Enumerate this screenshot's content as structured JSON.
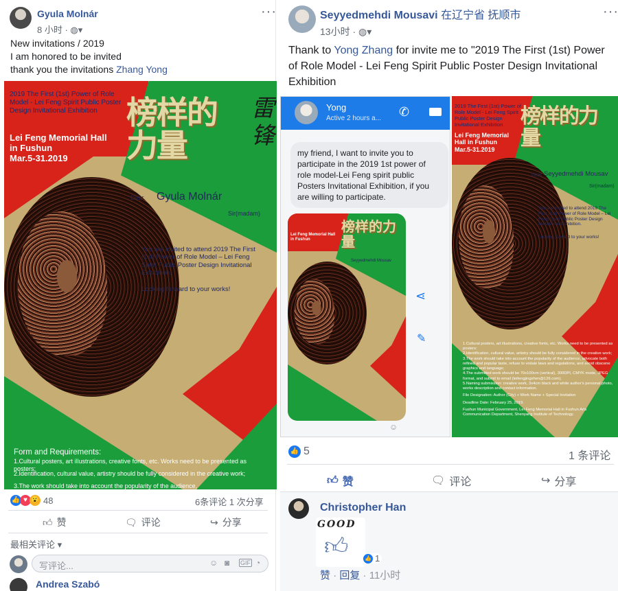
{
  "left_post": {
    "author": "Gyula Molnár",
    "time": "8 小时",
    "privacy_icon": "globe-icon",
    "body_lines": [
      "New invitations / 2019",
      "I am honored to be invited",
      "thank you the invitations "
    ],
    "mention": "Zhang Yong",
    "poster": {
      "title": "2019 The First (1st) Power of Role Model - Lei Feng Spirit Public Poster Design Invitational Exhibition",
      "venue": "Lei Feng Memorial Hall in Fushun",
      "dates": "Mar.5-31.2019",
      "dear": "Dear",
      "recipient": "Gyula Molnár",
      "sir": "Sir(madam)",
      "invite": "You are invited to attend 2019 The First (1st) Power of Role Model – Lei Feng Spirit Public Poster Design Invitational Exhibition.",
      "looking": "Looking forward to your works!",
      "form_head": "Form and Requirements:",
      "form_1": "1.Cultural posters, art illustrations, creative fonts, etc. Works need to be presented as posters:",
      "form_2": "2.Identification, cultural value, artistry should be fully considered in the creative work;",
      "form_3": "3.The work should take into account the popularity of the audience,",
      "calligraphy": "榜样的力量",
      "signature": "雷锋"
    },
    "reactions_count": "48",
    "comments_shares": "6条评论 1 次分享",
    "actions": {
      "like": "赞",
      "comment": "评论",
      "share": "分享"
    },
    "sort_label": "最相关评论",
    "comment_placeholder": "写评论...",
    "next_commenter": "Andrea Szabó"
  },
  "right_post": {
    "author": "Seyyedmehdi Mousavi",
    "location": "在辽宁省 抚顺市",
    "time": "13小时",
    "privacy_icon": "globe-icon",
    "body_prefix": "Thank to ",
    "mention": "Yong Zhang",
    "body_suffix": " for invite me to \"2019 The First (1st) Power of Role Model - Lei Feng Spirit Public Poster Design Invitational Exhibition",
    "messenger": {
      "contact": "Yong",
      "status": "Active 2 hours a...",
      "message": "my friend, I want to invite you to participate in the 2019 1st power of role model-Lei Feng spirit public Posters Invitational Exhibition, if you are willing to participate."
    },
    "poster": {
      "title": "2019 The First (1st) Power of Role Model - Lei Feng Spirit Public Poster Design Invitational Exhibition",
      "venue": "Lei Feng Memorial Hall in Fushun",
      "dates": "Mar.5-31.2019",
      "dear": "Dear",
      "recipient": "Seyyedmehdi Mousav",
      "sir": "Sir(madam)",
      "invite": "You are invited to attend 2019 The First (1st) Power of Role Model – Lei Feng Spirit Public Poster Design Invitational Exhibition.",
      "looking": "Looking forward to your works!",
      "form_1": "1.Cultural posters, art illustrations, creative fonts, etc. Works need to be presented as posters:",
      "form_2": "2.Identification, cultural value, artistry should be fully considered in the creative work;",
      "form_3": "3.The work should take into account the popularity of the audience, advocate both refined and popular taste, refuse to violate laws and regulations, and avoid obscene graphics and language;",
      "form_4": "4.The submitted work should be 70x100cm (vertical), 300DPI, CMYK mode, JPEG format, and submit to email (leifengjingshen@126.com);",
      "form_5": "5.Naming submission: creative work, 3x4cm black and white author's personal photo, works description and contact information.",
      "designation": "File Designation: Author (City) + Work Name + Special Invitation",
      "deadline": "Deadline Date: February 25, 2019.",
      "organizer": "Fushun Municipal Government, Lei Feng Memorial Hall in Fushun Arts Communication Department, Shenyang Institute of Technology.",
      "calligraphy": "榜样的力量"
    },
    "reactions_count": "5",
    "comments_count": "1 条评论",
    "actions": {
      "like": "赞",
      "comment": "评论",
      "share": "分享"
    },
    "commenter": "Christopher Han",
    "comment_sticker_text": "GOOD",
    "comment_reaction_count": "1",
    "comment_like": "赞",
    "comment_reply": "回复",
    "comment_time": "11小时"
  }
}
